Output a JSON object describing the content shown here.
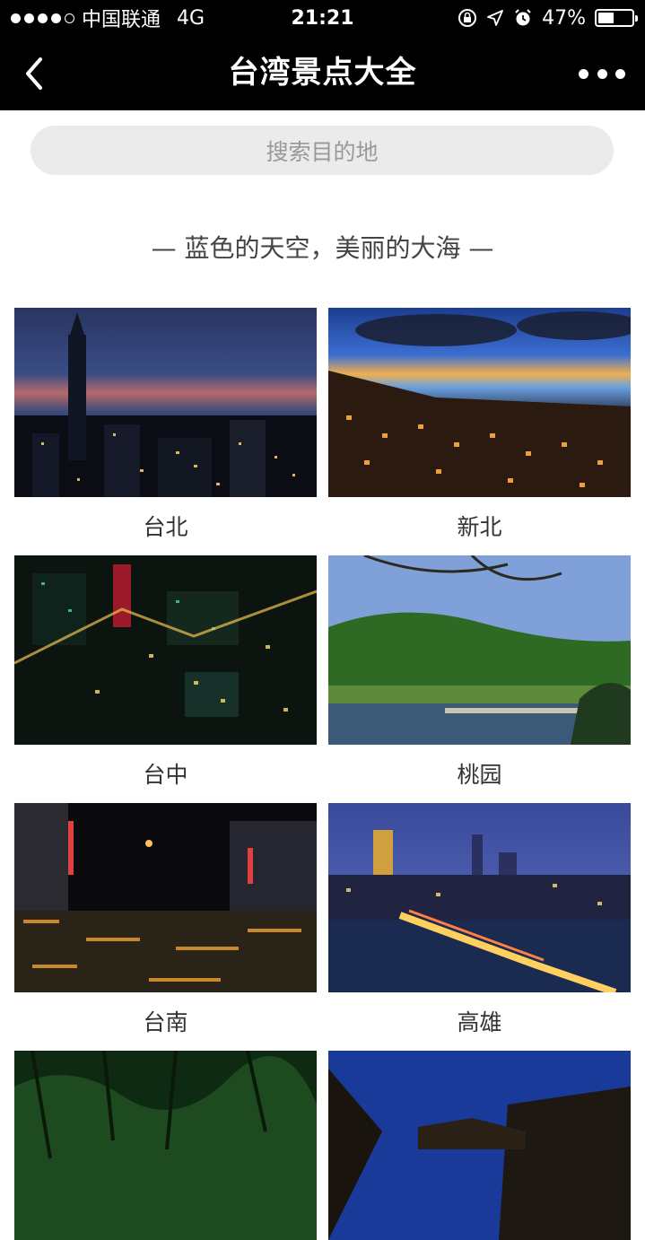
{
  "status_bar": {
    "carrier": "中国联通",
    "network": "4G",
    "time": "21:21",
    "battery": "47%",
    "battery_level": 0.47
  },
  "nav": {
    "title": "台湾景点大全"
  },
  "search": {
    "placeholder": "搜索目的地"
  },
  "slogan": "— 蓝色的天空，美丽的大海 —",
  "destinations": [
    {
      "label": "台北"
    },
    {
      "label": "新北"
    },
    {
      "label": "台中"
    },
    {
      "label": "桃园"
    },
    {
      "label": "台南"
    },
    {
      "label": "高雄"
    },
    {
      "label": ""
    },
    {
      "label": ""
    }
  ]
}
